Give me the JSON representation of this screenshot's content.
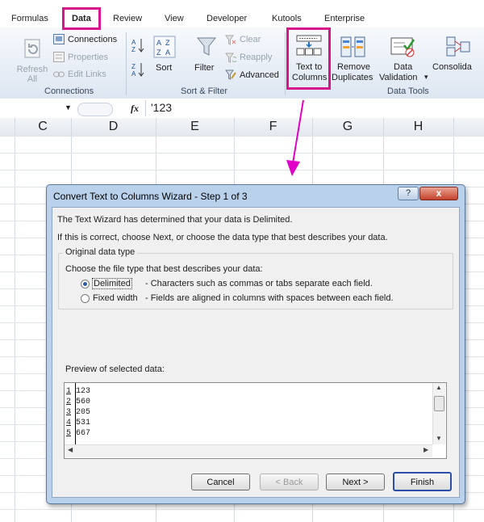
{
  "ribbon": {
    "tabs": [
      "Formulas",
      "Data",
      "Review",
      "View",
      "Developer",
      "Kutools",
      "Enterprise"
    ],
    "active_tab": "Data",
    "connections_group": {
      "refresh_all": "Refresh All",
      "connections": "Connections",
      "properties": "Properties",
      "edit_links": "Edit Links",
      "label": "Connections"
    },
    "sort_filter_group": {
      "sort": "Sort",
      "filter": "Filter",
      "clear": "Clear",
      "reapply": "Reapply",
      "advanced": "Advanced",
      "label": "Sort & Filter"
    },
    "data_tools_group": {
      "text_to_columns_l1": "Text to",
      "text_to_columns_l2": "Columns",
      "remove_duplicates_l1": "Remove",
      "remove_duplicates_l2": "Duplicates",
      "data_validation_l1": "Data",
      "data_validation_l2": "Validation",
      "consolidate": "Consolida",
      "label": "Data Tools"
    }
  },
  "formula_bar": {
    "fx": "fx",
    "value": "'123"
  },
  "columns": [
    "C",
    "D",
    "E",
    "F",
    "G",
    "H"
  ],
  "dialog": {
    "title": "Convert Text to Columns Wizard - Step 1 of 3",
    "help": "?",
    "close": "x",
    "line1": "The Text Wizard has determined that your data is Delimited.",
    "line2": "If this is correct, choose Next, or choose the data type that best describes your data.",
    "group_label": "Original data type",
    "choose_label": "Choose the file type that best describes your data:",
    "options": [
      {
        "label": "Delimited",
        "desc": "- Characters such as commas or tabs separate each field.",
        "selected": true
      },
      {
        "label": "Fixed width",
        "desc": "- Fields are aligned in columns with spaces between each field.",
        "selected": false
      }
    ],
    "preview_label": "Preview of selected data:",
    "preview_rows": [
      {
        "n": "1",
        "v": "123"
      },
      {
        "n": "2",
        "v": "560"
      },
      {
        "n": "3",
        "v": "205"
      },
      {
        "n": "4",
        "v": "531"
      },
      {
        "n": "5",
        "v": "667"
      }
    ],
    "buttons": {
      "cancel": "Cancel",
      "back": "< Back",
      "next": "Next >",
      "finish": "Finish"
    }
  },
  "colors": {
    "highlight": "#d8148d",
    "accent": "#2d5fa8"
  }
}
